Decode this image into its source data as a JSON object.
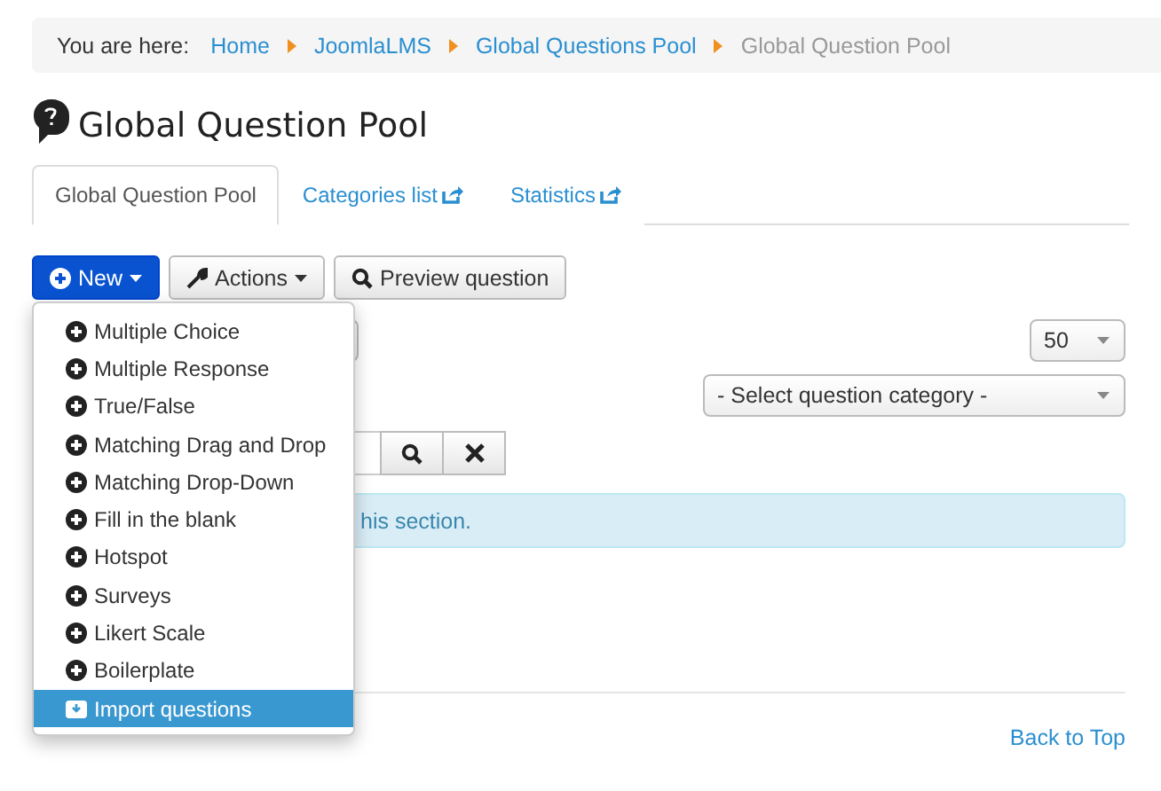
{
  "breadcrumb": {
    "label": "You are here:",
    "items": [
      {
        "text": "Home",
        "current": false
      },
      {
        "text": "JoomlaLMS",
        "current": false
      },
      {
        "text": "Global Questions Pool",
        "current": false
      },
      {
        "text": "Global Question Pool",
        "current": true
      }
    ]
  },
  "title": "Global Question Pool",
  "tabs": [
    {
      "label": "Global Question Pool",
      "selected": true,
      "external": false
    },
    {
      "label": "Categories list",
      "selected": false,
      "external": true
    },
    {
      "label": "Statistics",
      "selected": false,
      "external": true
    }
  ],
  "toolbar": {
    "new": "New",
    "actions": "Actions",
    "preview": "Preview question"
  },
  "new_menu": [
    {
      "label": "Multiple Choice",
      "kind": "add",
      "selected": false
    },
    {
      "label": "Multiple Response",
      "kind": "add",
      "selected": false
    },
    {
      "label": "True/False",
      "kind": "add",
      "selected": false
    },
    {
      "label": "Matching Drag and Drop",
      "kind": "add",
      "selected": false
    },
    {
      "label": "Matching Drop-Down",
      "kind": "add",
      "selected": false
    },
    {
      "label": "Fill in the blank",
      "kind": "add",
      "selected": false
    },
    {
      "label": "Hotspot",
      "kind": "add",
      "selected": false
    },
    {
      "label": "Surveys",
      "kind": "add",
      "selected": false
    },
    {
      "label": "Likert Scale",
      "kind": "add",
      "selected": false
    },
    {
      "label": "Boilerplate",
      "kind": "add",
      "selected": false
    },
    {
      "label": "Import questions",
      "kind": "import",
      "selected": true
    }
  ],
  "page_size": "50",
  "category_select": "- Select question category -",
  "alert": "his section.",
  "footer": {
    "back_to_top": "Back to Top"
  }
}
